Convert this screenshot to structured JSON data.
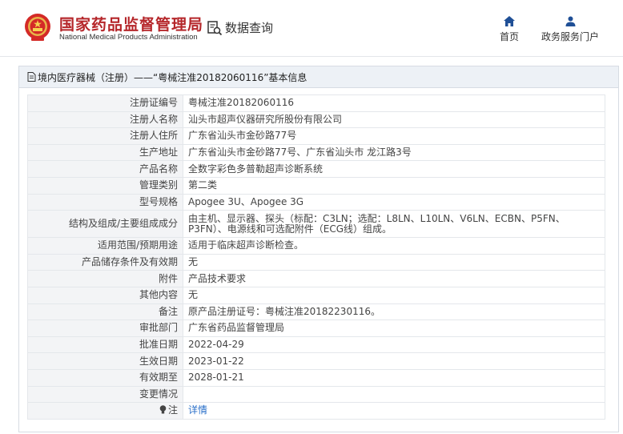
{
  "header": {
    "title_cn": "国家药品监督管理局",
    "title_en": "National Medical Products Administration",
    "search_label": "数据查询",
    "nav": [
      {
        "label": "首页",
        "icon": "home-icon"
      },
      {
        "label": "政务服务门户",
        "icon": "user-icon"
      }
    ]
  },
  "colors": {
    "brand": "#b5262a",
    "nav_icon": "#1f4f96",
    "link": "#2a6fc9",
    "label_bg": "#f3f4f6"
  },
  "breadcrumb": "境内医疗器械（注册）——“粤械注准20182060116”基本信息",
  "rows": [
    {
      "label": "注册证编号",
      "value": "粤械注准20182060116"
    },
    {
      "label": "注册人名称",
      "value": "汕头市超声仪器研究所股份有限公司"
    },
    {
      "label": "注册人住所",
      "value": "广东省汕头市金砂路77号"
    },
    {
      "label": "生产地址",
      "value": "广东省汕头市金砂路77号、广东省汕头市 龙江路3号"
    },
    {
      "label": "产品名称",
      "value": "全数字彩色多普勒超声诊断系统"
    },
    {
      "label": "管理类别",
      "value": "第二类"
    },
    {
      "label": "型号规格",
      "value": "Apogee 3U、Apogee 3G"
    },
    {
      "label": "结构及组成/主要组成成分",
      "value": "由主机、显示器、探头（标配：C3LN；选配：L8LN、L10LN、V6LN、ECBN、P5FN、P3FN）、电源线和可选配附件（ECG线）组成。"
    },
    {
      "label": "适用范围/预期用途",
      "value": "适用于临床超声诊断检查。"
    },
    {
      "label": "产品储存条件及有效期",
      "value": "无"
    },
    {
      "label": "附件",
      "value": "产品技术要求"
    },
    {
      "label": "其他内容",
      "value": "无"
    },
    {
      "label": "备注",
      "value": "原产品注册证号：粤械注准20182230116。"
    },
    {
      "label": "审批部门",
      "value": "广东省药品监督管理局"
    },
    {
      "label": "批准日期",
      "value": "2022-04-29"
    },
    {
      "label": "生效日期",
      "value": "2023-01-22"
    },
    {
      "label": "有效期至",
      "value": "2028-01-21"
    },
    {
      "label": "变更情况",
      "value": ""
    }
  ],
  "note": {
    "label": "注",
    "icon": "lightbulb-icon",
    "link": "详情"
  }
}
